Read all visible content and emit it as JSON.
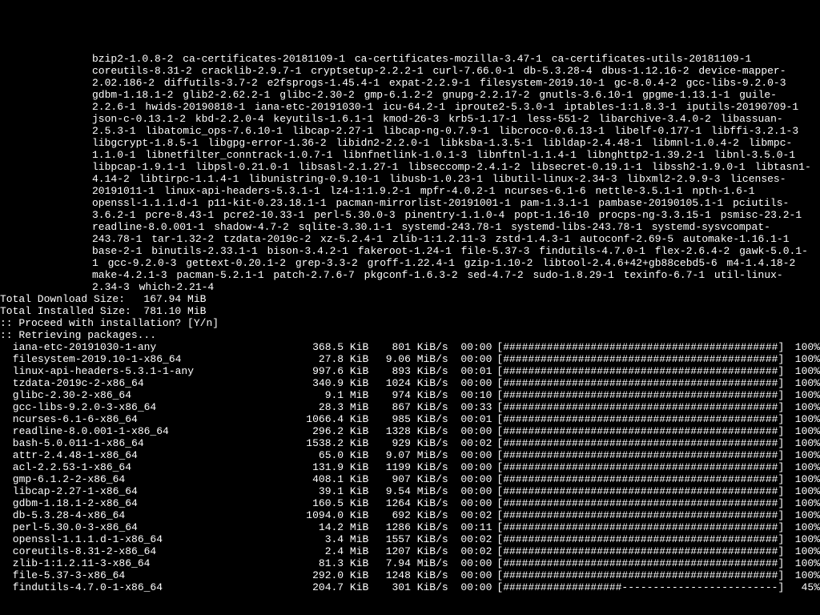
{
  "packages_block": "bzip2-1.0.8-2  ca-certificates-20181109-1  ca-certificates-mozilla-3.47-1  ca-certificates-utils-20181109-1  coreutils-8.31-2  cracklib-2.9.7-1  cryptsetup-2.2.2-1  curl-7.66.0-1  db-5.3.28-4  dbus-1.12.16-2  device-mapper-2.02.186-2  diffutils-3.7-2  e2fsprogs-1.45.4-1  expat-2.2.9-1  filesystem-2019.10-1  gc-8.0.4-2  gcc-libs-9.2.0-3  gdbm-1.18.1-2  glib2-2.62.2-1  glibc-2.30-2  gmp-6.1.2-2  gnupg-2.2.17-2  gnutls-3.6.10-1  gpgme-1.13.1-1  guile-2.2.6-1  hwids-20190818-1  iana-etc-20191030-1  icu-64.2-1  iproute2-5.3.0-1  iptables-1:1.8.3-1  iputils-20190709-1  json-c-0.13.1-2  kbd-2.2.0-4  keyutils-1.6.1-1  kmod-26-3  krb5-1.17-1  less-551-2  libarchive-3.4.0-2  libassuan-2.5.3-1  libatomic_ops-7.6.10-1  libcap-2.27-1  libcap-ng-0.7.9-1  libcroco-0.6.13-1  libelf-0.177-1  libffi-3.2.1-3  libgcrypt-1.8.5-1  libgpg-error-1.36-2  libidn2-2.2.0-1  libksba-1.3.5-1  libldap-2.4.48-1  libmnl-1.0.4-2  libmpc-1.1.0-1  libnetfilter_conntrack-1.0.7-1  libnfnetlink-1.0.1-3  libnftnl-1.1.4-1  libnghttp2-1.39.2-1  libnl-3.5.0-1  libpcap-1.9.1-1  libpsl-0.21.0-1  libsasl-2.1.27-1  libseccomp-2.4.1-2  libsecret-0.19.1-1  libssh2-1.9.0-1  libtasn1-4.14-2  libtirpc-1.1.4-1  libunistring-0.9.10-1  libusb-1.0.23-1  libutil-linux-2.34-3  libxml2-2.9.9-3  licenses-20191011-1  linux-api-headers-5.3.1-1  lz4-1:1.9.2-1  mpfr-4.0.2-1  ncurses-6.1-6  nettle-3.5.1-1  npth-1.6-1  openssl-1.1.1.d-1  p11-kit-0.23.18.1-1  pacman-mirrorlist-20191001-1  pam-1.3.1-1  pambase-20190105.1-1  pciutils-3.6.2-1  pcre-8.43-1  pcre2-10.33-1  perl-5.30.0-3  pinentry-1.1.0-4  popt-1.16-10  procps-ng-3.3.15-1  psmisc-23.2-1  readline-8.0.001-1  shadow-4.7-2  sqlite-3.30.1-1  systemd-243.78-1  systemd-libs-243.78-1  systemd-sysvcompat-243.78-1  tar-1.32-2  tzdata-2019c-2  xz-5.2.4-1  zlib-1:1.2.11-3  zstd-1.4.3-1  autoconf-2.69-5  automake-1.16.1-1  base-2-1  binutils-2.33.1-1  bison-3.4.2-1  fakeroot-1.24-1  file-5.37-3  findutils-4.7.0-1  flex-2.6.4-2  gawk-5.0.1-1  gcc-9.2.0-3  gettext-0.20.1-2  grep-3.3-2  groff-1.22.4-1  gzip-1.10-2  libtool-2.4.6+42+gb88cebd5-6  m4-1.4.18-2  make-4.2.1-3  pacman-5.2.1-1  patch-2.7.6-7  pkgconf-1.6.3-2  sed-4.7-2  sudo-1.8.29-1  texinfo-6.7-1  util-linux-2.34-3  which-2.21-4",
  "total_download_label": "Total Download Size:",
  "total_download_value": "167.94 MiB",
  "total_installed_label": "Total Installed Size:",
  "total_installed_value": "781.10 MiB",
  "proceed_prompt": ":: Proceed with installation? [Y/n]",
  "retrieving": ":: Retrieving packages...",
  "downloads": [
    {
      "name": "iana-etc-20191030-1-any",
      "size": "368.5 KiB",
      "rate": "801 KiB/s",
      "time": "00:00",
      "bar": "[############################################]",
      "pct": "100%"
    },
    {
      "name": "filesystem-2019.10-1-x86_64",
      "size": "27.8 KiB",
      "rate": "9.06 MiB/s",
      "time": "00:00",
      "bar": "[############################################]",
      "pct": "100%"
    },
    {
      "name": "linux-api-headers-5.3.1-1-any",
      "size": "997.6 KiB",
      "rate": "893 KiB/s",
      "time": "00:01",
      "bar": "[############################################]",
      "pct": "100%"
    },
    {
      "name": "tzdata-2019c-2-x86_64",
      "size": "340.9 KiB",
      "rate": "1024 KiB/s",
      "time": "00:00",
      "bar": "[############################################]",
      "pct": "100%"
    },
    {
      "name": "glibc-2.30-2-x86_64",
      "size": "9.1 MiB",
      "rate": "974 KiB/s",
      "time": "00:10",
      "bar": "[############################################]",
      "pct": "100%"
    },
    {
      "name": "gcc-libs-9.2.0-3-x86_64",
      "size": "28.3 MiB",
      "rate": "867 KiB/s",
      "time": "00:33",
      "bar": "[############################################]",
      "pct": "100%"
    },
    {
      "name": "ncurses-6.1-6-x86_64",
      "size": "1066.4 KiB",
      "rate": "985 KiB/s",
      "time": "00:01",
      "bar": "[############################################]",
      "pct": "100%"
    },
    {
      "name": "readline-8.0.001-1-x86_64",
      "size": "296.2 KiB",
      "rate": "1328 KiB/s",
      "time": "00:00",
      "bar": "[############################################]",
      "pct": "100%"
    },
    {
      "name": "bash-5.0.011-1-x86_64",
      "size": "1538.2 KiB",
      "rate": "929 KiB/s",
      "time": "00:02",
      "bar": "[############################################]",
      "pct": "100%"
    },
    {
      "name": "attr-2.4.48-1-x86_64",
      "size": "65.0 KiB",
      "rate": "9.07 MiB/s",
      "time": "00:00",
      "bar": "[############################################]",
      "pct": "100%"
    },
    {
      "name": "acl-2.2.53-1-x86_64",
      "size": "131.9 KiB",
      "rate": "1199 KiB/s",
      "time": "00:00",
      "bar": "[############################################]",
      "pct": "100%"
    },
    {
      "name": "gmp-6.1.2-2-x86_64",
      "size": "408.1 KiB",
      "rate": "907 KiB/s",
      "time": "00:00",
      "bar": "[############################################]",
      "pct": "100%"
    },
    {
      "name": "libcap-2.27-1-x86_64",
      "size": "39.1 KiB",
      "rate": "9.54 MiB/s",
      "time": "00:00",
      "bar": "[############################################]",
      "pct": "100%"
    },
    {
      "name": "gdbm-1.18.1-2-x86_64",
      "size": "160.5 KiB",
      "rate": "1264 KiB/s",
      "time": "00:00",
      "bar": "[############################################]",
      "pct": "100%"
    },
    {
      "name": "db-5.3.28-4-x86_64",
      "size": "1094.0 KiB",
      "rate": "692 KiB/s",
      "time": "00:02",
      "bar": "[############################################]",
      "pct": "100%"
    },
    {
      "name": "perl-5.30.0-3-x86_64",
      "size": "14.2 MiB",
      "rate": "1286 KiB/s",
      "time": "00:11",
      "bar": "[############################################]",
      "pct": "100%"
    },
    {
      "name": "openssl-1.1.1.d-1-x86_64",
      "size": "3.4 MiB",
      "rate": "1557 KiB/s",
      "time": "00:02",
      "bar": "[############################################]",
      "pct": "100%"
    },
    {
      "name": "coreutils-8.31-2-x86_64",
      "size": "2.4 MiB",
      "rate": "1207 KiB/s",
      "time": "00:02",
      "bar": "[############################################]",
      "pct": "100%"
    },
    {
      "name": "zlib-1:1.2.11-3-x86_64",
      "size": "81.3 KiB",
      "rate": "7.94 MiB/s",
      "time": "00:00",
      "bar": "[############################################]",
      "pct": "100%"
    },
    {
      "name": "file-5.37-3-x86_64",
      "size": "292.0 KiB",
      "rate": "1248 KiB/s",
      "time": "00:00",
      "bar": "[############################################]",
      "pct": "100%"
    },
    {
      "name": "findutils-4.7.0-1-x86_64",
      "size": "204.7 KiB",
      "rate": "301 KiB/s",
      "time": "00:00",
      "bar": "[###################-------------------------]",
      "pct": "45%"
    }
  ]
}
